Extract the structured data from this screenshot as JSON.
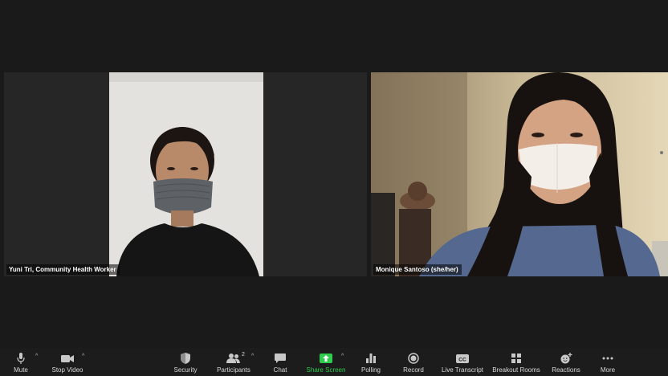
{
  "participants": [
    {
      "name": "Yuni Tri, Community Health Worker"
    },
    {
      "name": "Monique Santoso (she/her)"
    }
  ],
  "toolbar": {
    "mute": {
      "label": "Mute",
      "icon": "microphone-icon"
    },
    "stop_video": {
      "label": "Stop Video",
      "icon": "video-camera-icon"
    },
    "security": {
      "label": "Security",
      "icon": "shield-icon"
    },
    "participants": {
      "label": "Participants",
      "icon": "people-icon",
      "count": "2"
    },
    "chat": {
      "label": "Chat",
      "icon": "chat-bubble-icon"
    },
    "share_screen": {
      "label": "Share Screen",
      "icon": "share-arrow-icon",
      "color": "#2fcc4e"
    },
    "polling": {
      "label": "Polling",
      "icon": "bar-chart-icon"
    },
    "record": {
      "label": "Record",
      "icon": "record-icon"
    },
    "live_transcript": {
      "label": "Live Transcript",
      "icon": "cc-icon"
    },
    "breakout_rooms": {
      "label": "Breakout Rooms",
      "icon": "grid-icon"
    },
    "reactions": {
      "label": "Reactions",
      "icon": "emoji-plus-icon"
    },
    "more": {
      "label": "More",
      "icon": "ellipsis-icon"
    }
  }
}
